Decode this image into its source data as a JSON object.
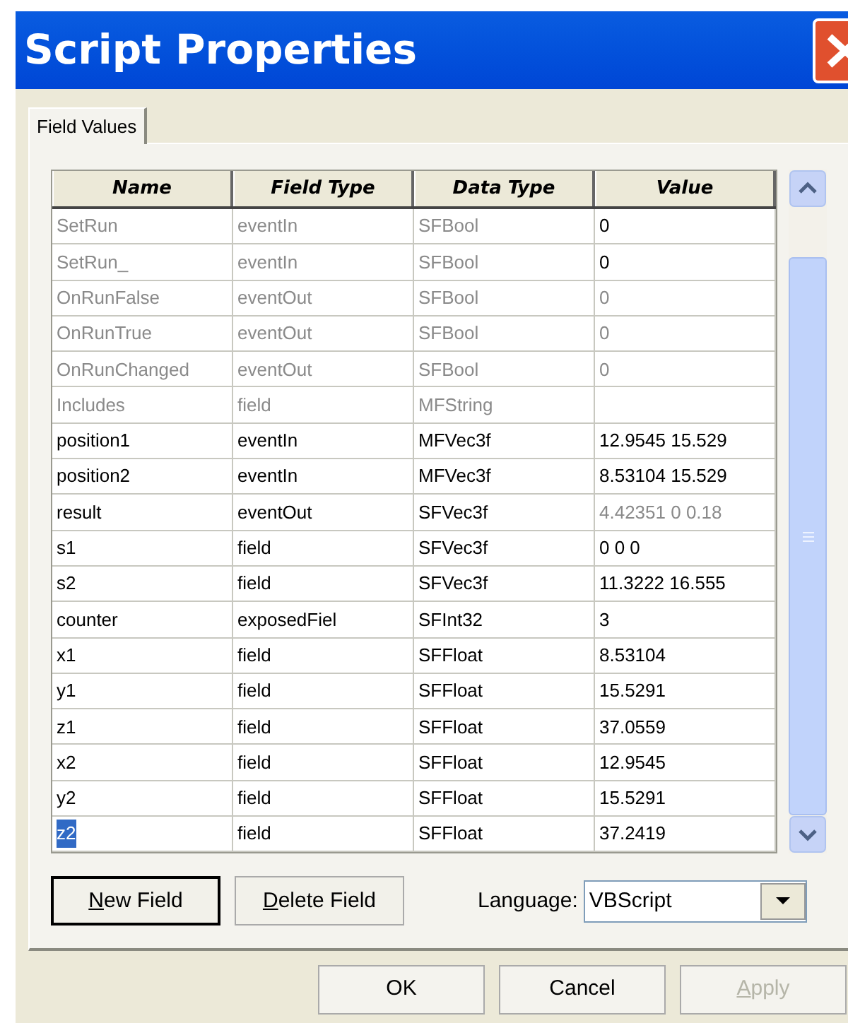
{
  "window": {
    "title": "Script Properties"
  },
  "tabs": [
    {
      "label": "Field Values",
      "selected": true
    }
  ],
  "table": {
    "columns": [
      "Name",
      "Field Type",
      "Data Type",
      "Value"
    ],
    "rows": [
      {
        "name": "SetRun",
        "field_type": "eventIn",
        "data_type": "SFBool",
        "value": "0",
        "disabled": true,
        "value_disabled": false,
        "selected": false
      },
      {
        "name": "SetRun_",
        "field_type": "eventIn",
        "data_type": "SFBool",
        "value": "0",
        "disabled": true,
        "value_disabled": false,
        "selected": false
      },
      {
        "name": "OnRunFalse",
        "field_type": "eventOut",
        "data_type": "SFBool",
        "value": "0",
        "disabled": true,
        "value_disabled": true,
        "selected": false
      },
      {
        "name": "OnRunTrue",
        "field_type": "eventOut",
        "data_type": "SFBool",
        "value": "0",
        "disabled": true,
        "value_disabled": true,
        "selected": false
      },
      {
        "name": "OnRunChanged",
        "field_type": "eventOut",
        "data_type": "SFBool",
        "value": "0",
        "disabled": true,
        "value_disabled": true,
        "selected": false
      },
      {
        "name": "Includes",
        "field_type": "field",
        "data_type": "MFString",
        "disabled": true,
        "selected": false
      },
      {
        "name": "position1",
        "field_type": "eventIn",
        "data_type": "MFVec3f",
        "value": "12.9545 15.529",
        "disabled": false,
        "value_disabled": false,
        "selected": false
      },
      {
        "name": "position2",
        "field_type": "eventIn",
        "data_type": "MFVec3f",
        "value": "8.53104 15.529",
        "disabled": false,
        "value_disabled": false,
        "selected": false
      },
      {
        "name": "result",
        "field_type": "eventOut",
        "data_type": "SFVec3f",
        "value": "4.42351 0 0.18",
        "disabled": false,
        "value_disabled": true,
        "selected": false
      },
      {
        "name": "s1",
        "field_type": "field",
        "data_type": "SFVec3f",
        "value": "0 0 0",
        "disabled": false,
        "value_disabled": false,
        "selected": false
      },
      {
        "name": "s2",
        "field_type": "field",
        "data_type": "SFVec3f",
        "value": "11.3222 16.555",
        "disabled": false,
        "value_disabled": false,
        "selected": false
      },
      {
        "name": "counter",
        "field_type": "exposedFiel",
        "data_type": "SFInt32",
        "value": "3",
        "disabled": false,
        "value_disabled": false,
        "selected": false
      },
      {
        "name": "x1",
        "field_type": "field",
        "data_type": "SFFloat",
        "value": "8.53104",
        "disabled": false,
        "value_disabled": false,
        "selected": false
      },
      {
        "name": "y1",
        "field_type": "field",
        "data_type": "SFFloat",
        "value": "15.5291",
        "disabled": false,
        "value_disabled": false,
        "selected": false
      },
      {
        "name": "z1",
        "field_type": "field",
        "data_type": "SFFloat",
        "value": "37.0559",
        "disabled": false,
        "value_disabled": false,
        "selected": false
      },
      {
        "name": "x2",
        "field_type": "field",
        "data_type": "SFFloat",
        "value": "12.9545",
        "disabled": false,
        "value_disabled": false,
        "selected": false
      },
      {
        "name": "y2",
        "field_type": "field",
        "data_type": "SFFloat",
        "value": "15.5291",
        "disabled": false,
        "value_disabled": false,
        "selected": false
      },
      {
        "name": "z2",
        "field_type": "field",
        "data_type": "SFFloat",
        "value": "37.2419",
        "disabled": false,
        "value_disabled": false,
        "selected": true
      }
    ]
  },
  "field_buttons": [
    {
      "label": "New Field",
      "default": true,
      "underline_first": true
    },
    {
      "label": "Delete Field",
      "default": false,
      "underline_first": true
    }
  ],
  "language": {
    "label": "Language:",
    "value": "VBScript"
  },
  "dialog_buttons": [
    {
      "label": "OK",
      "disabled": false,
      "underline_first": false
    },
    {
      "label": "Cancel",
      "disabled": false,
      "underline_first": false
    },
    {
      "label": "Apply",
      "disabled": true,
      "underline_first": true
    }
  ]
}
